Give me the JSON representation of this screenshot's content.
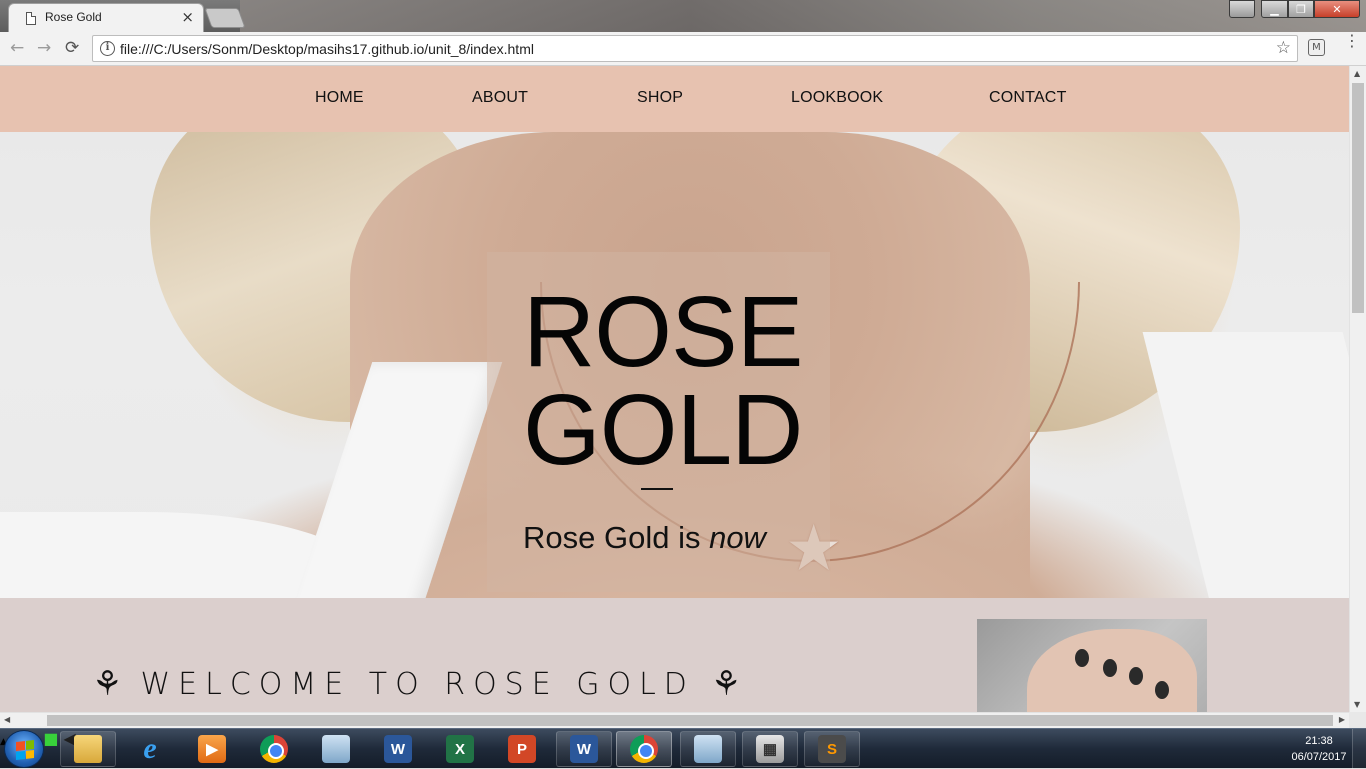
{
  "browser": {
    "tab_title": "Rose Gold",
    "tab_close": "×",
    "url": "file:///C:/Users/Sonm/Desktop/masihs17.github.io/unit_8/index.html",
    "back": "←",
    "forward": "→",
    "reload": "⟳",
    "star": "☆",
    "info": "i",
    "menu": "⋮"
  },
  "site": {
    "nav": [
      "HOME",
      "ABOUT",
      "SHOP",
      "LOOKBOOK",
      "CONTACT"
    ],
    "hero": {
      "title_line1": "ROSE",
      "title_line2": "GOLD",
      "tagline_prefix": "Rose Gold is ",
      "tagline_emphasis": "now"
    },
    "welcome": {
      "heading": "WELCOME TO ROSE GOLD",
      "rose_glyph": "🌹"
    }
  },
  "taskbar": {
    "time": "21:38",
    "date": "06/07/2017",
    "apps": [
      "file-explorer",
      "internet-explorer",
      "media-player",
      "chrome",
      "photo-viewer",
      "word",
      "excel",
      "powerpoint",
      "word",
      "chrome",
      "photos",
      "calculator",
      "sublime-text"
    ]
  },
  "colors": {
    "nav_bg": "#e7c2b0",
    "title_box": "#d2b4a2",
    "section_bg": "#dbcfcd"
  }
}
